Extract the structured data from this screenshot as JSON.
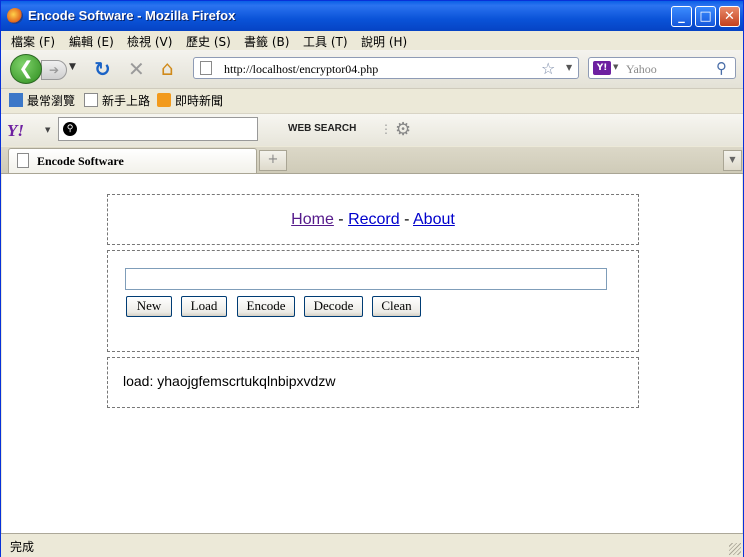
{
  "window": {
    "title": "Encode Software - Mozilla Firefox"
  },
  "menubar": {
    "items": [
      "檔案 (F)",
      "編輯 (E)",
      "檢視 (V)",
      "歷史 (S)",
      "書籤 (B)",
      "工具 (T)",
      "說明 (H)"
    ]
  },
  "navbar": {
    "url": "http://localhost/encryptor04.php",
    "search_placeholder": "Yahoo"
  },
  "bookmarks": {
    "items": [
      "最常瀏覽",
      "新手上路",
      "即時新聞"
    ]
  },
  "yahoo_toolbar": {
    "logo": "Y!",
    "web_search_label": "WEB SEARCH"
  },
  "tabs": {
    "active_label": "Encode Software"
  },
  "page": {
    "nav": {
      "home": "Home",
      "sep1": " - ",
      "record": "Record",
      "sep2": " - ",
      "about": "About"
    },
    "input_value": "",
    "buttons": {
      "new": "New",
      "load": "Load",
      "encode": "Encode",
      "decode": "Decode",
      "clean": "Clean"
    },
    "output": "load: yhaojgfemscrtukqlnbipxvdzw"
  },
  "status": {
    "text": "完成"
  },
  "colors": {
    "visited_link": "#551a8b",
    "link": "#0000cc",
    "titlebar": "#0a53d8"
  }
}
